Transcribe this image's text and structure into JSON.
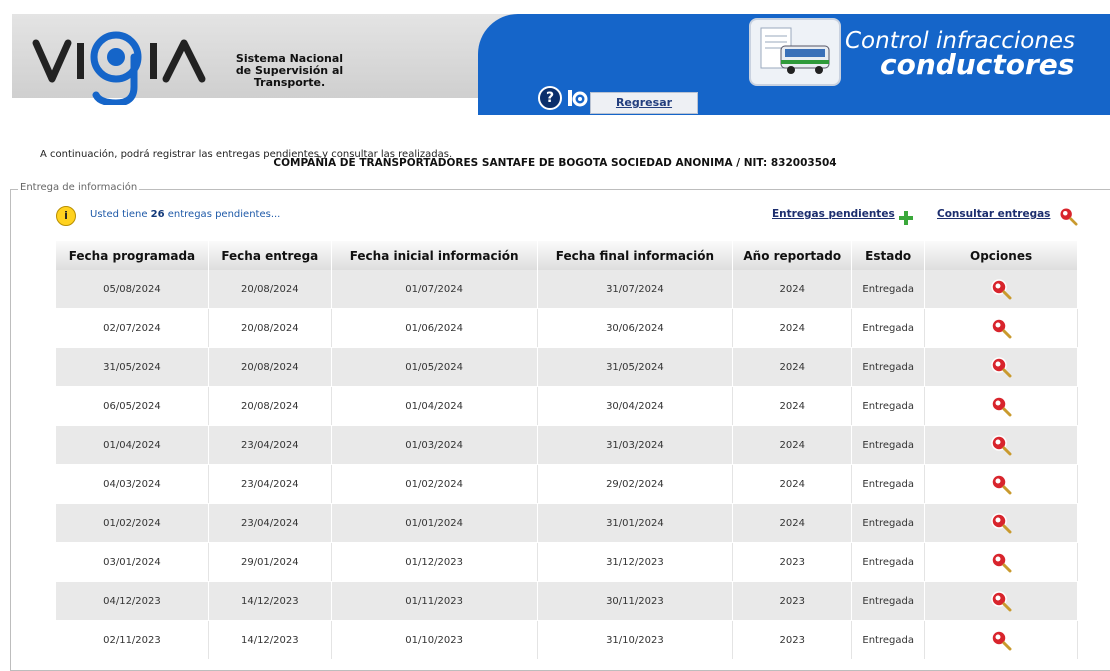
{
  "header": {
    "logo_text": "VIGIA",
    "logo_subtitle": "Sistema Nacional de Supervisión al Transporte.",
    "back_label": "Regresar",
    "help_icon": "help-icon",
    "home_icon": "home-icon",
    "module_title_line1": "Control infracciones",
    "module_title_line2": "conductores",
    "brand_blue": "#1565c9"
  },
  "intro_text": "A continuación, podrá registrar las entregas pendientes y consultar las realizadas.",
  "company": "COMPAÑIA DE TRANSPORTADORES SANTAFE DE BOGOTA SOCIEDAD ANONIMA / NIT: 832003504",
  "section": {
    "legend": "Entrega de información",
    "pending_prefix": "Usted tiene ",
    "pending_count": "26",
    "pending_suffix": " entregas pendientes...",
    "link_pendientes": "Entregas pendientes",
    "link_consultar": "Consultar entregas"
  },
  "table": {
    "columns": [
      "Fecha programada",
      "Fecha entrega",
      "Fecha inicial información",
      "Fecha final información",
      "Año reportado",
      "Estado",
      "Opciones"
    ],
    "rows": [
      [
        "05/08/2024",
        "20/08/2024",
        "01/07/2024",
        "31/07/2024",
        "2024",
        "Entregada"
      ],
      [
        "02/07/2024",
        "20/08/2024",
        "01/06/2024",
        "30/06/2024",
        "2024",
        "Entregada"
      ],
      [
        "31/05/2024",
        "20/08/2024",
        "01/05/2024",
        "31/05/2024",
        "2024",
        "Entregada"
      ],
      [
        "06/05/2024",
        "20/08/2024",
        "01/04/2024",
        "30/04/2024",
        "2024",
        "Entregada"
      ],
      [
        "01/04/2024",
        "23/04/2024",
        "01/03/2024",
        "31/03/2024",
        "2024",
        "Entregada"
      ],
      [
        "04/03/2024",
        "23/04/2024",
        "01/02/2024",
        "29/02/2024",
        "2024",
        "Entregada"
      ],
      [
        "01/02/2024",
        "23/04/2024",
        "01/01/2024",
        "31/01/2024",
        "2024",
        "Entregada"
      ],
      [
        "03/01/2024",
        "29/01/2024",
        "01/12/2023",
        "31/12/2023",
        "2023",
        "Entregada"
      ],
      [
        "04/12/2023",
        "14/12/2023",
        "01/11/2023",
        "30/11/2023",
        "2023",
        "Entregada"
      ],
      [
        "02/11/2023",
        "14/12/2023",
        "01/10/2023",
        "31/10/2023",
        "2023",
        "Entregada"
      ]
    ]
  }
}
